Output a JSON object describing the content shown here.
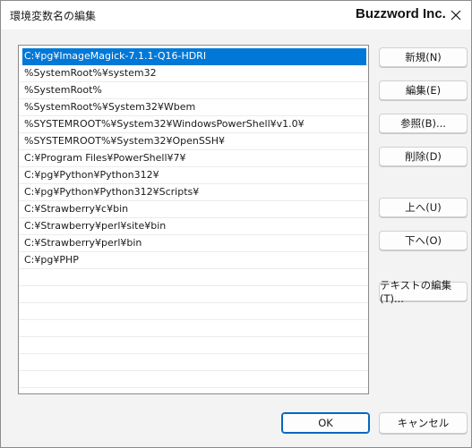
{
  "window": {
    "title": "環境変数名の編集",
    "brand": "Buzzword Inc."
  },
  "list": {
    "items": [
      "C:¥pg¥ImageMagick-7.1.1-Q16-HDRI",
      "%SystemRoot%¥system32",
      "%SystemRoot%",
      "%SystemRoot%¥System32¥Wbem",
      "%SYSTEMROOT%¥System32¥WindowsPowerShell¥v1.0¥",
      "%SYSTEMROOT%¥System32¥OpenSSH¥",
      "C:¥Program Files¥PowerShell¥7¥",
      "C:¥pg¥Python¥Python312¥",
      "C:¥pg¥Python¥Python312¥Scripts¥",
      "C:¥Strawberry¥c¥bin",
      "C:¥Strawberry¥perl¥site¥bin",
      "C:¥Strawberry¥perl¥bin",
      "C:¥pg¥PHP"
    ],
    "selected_index": 0,
    "empty_rows": 7
  },
  "buttons": {
    "new": "新規(N)",
    "edit": "編集(E)",
    "browse": "参照(B)...",
    "delete": "削除(D)",
    "up": "上へ(U)",
    "down": "下へ(O)",
    "edit_text": "テキストの編集(T)...",
    "ok": "OK",
    "cancel": "キャンセル"
  },
  "colors": {
    "selection": "#0078d7",
    "primary_border": "#0067c0"
  },
  "icons": {
    "close": "close-icon"
  }
}
